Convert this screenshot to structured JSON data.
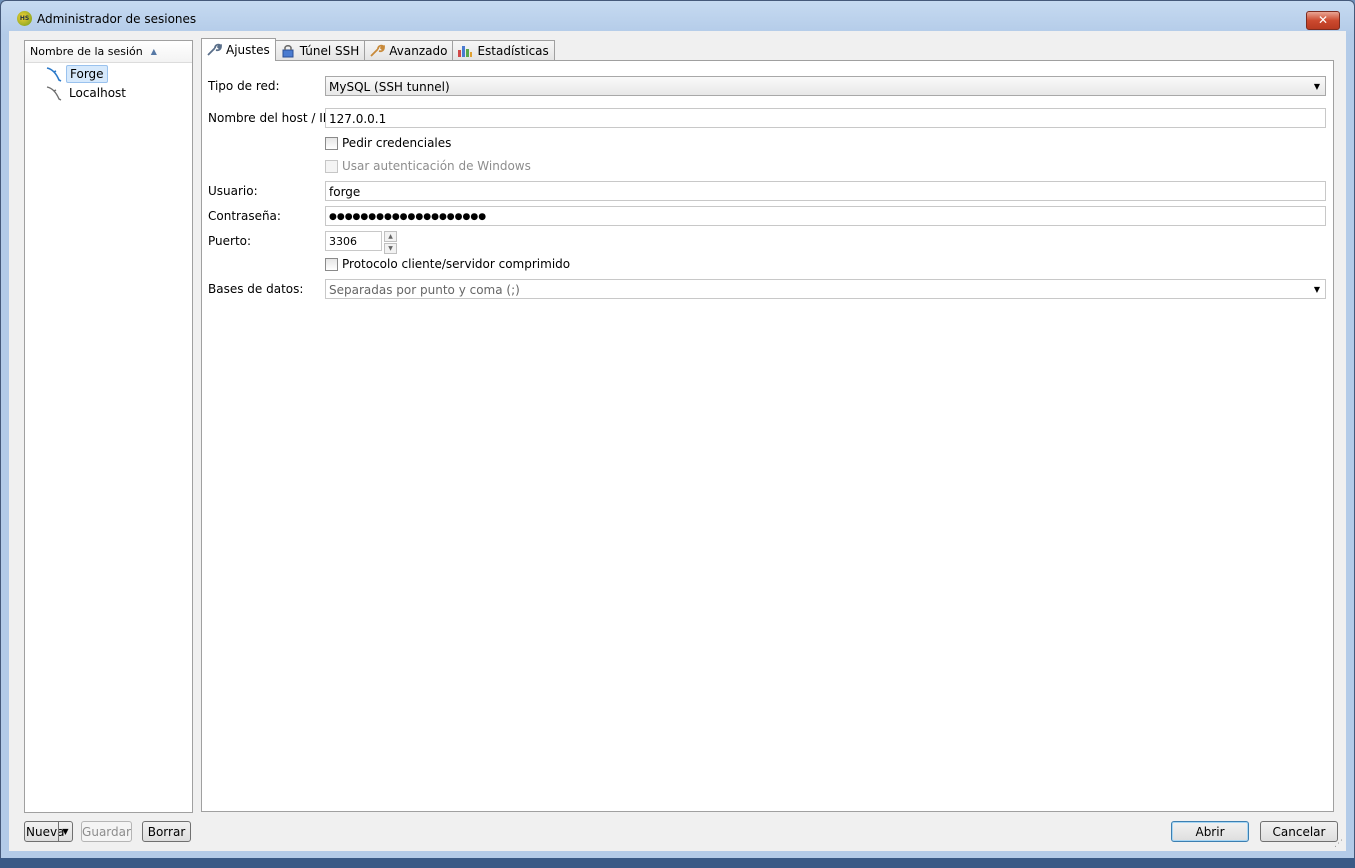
{
  "window": {
    "title": "Administrador de sesiones",
    "app_icon_text": "HS",
    "close_glyph": "✕"
  },
  "tree": {
    "header": "Nombre de la sesión",
    "sort_glyph": "▲",
    "items": [
      {
        "label": "Forge",
        "icon": "dolphin-icon",
        "selected": true
      },
      {
        "label": "Localhost",
        "icon": "dolphin-icon",
        "selected": false
      }
    ]
  },
  "tabs": [
    {
      "label": "Ajustes",
      "icon": "wrench-icon",
      "active": true
    },
    {
      "label": "Túnel SSH",
      "icon": "lock-icon",
      "active": false
    },
    {
      "label": "Avanzado",
      "icon": "wrench-icon",
      "active": false
    },
    {
      "label": "Estadísticas",
      "icon": "bar-chart-icon",
      "active": false
    }
  ],
  "settings": {
    "network_type_label": "Tipo de red:",
    "network_type_value": "MySQL (SSH tunnel)",
    "host_label": "Nombre del host / IP:",
    "host_value": "127.0.0.1",
    "prompt_credentials_label": "Pedir credenciales",
    "prompt_credentials_checked": false,
    "windows_auth_label": "Usar autenticación de Windows",
    "windows_auth_enabled": false,
    "user_label": "Usuario:",
    "user_value": "forge",
    "password_label": "Contraseña:",
    "password_value": "●●●●●●●●●●●●●●●●●●●●",
    "port_label": "Puerto:",
    "port_value": "3306",
    "compressed_label": "Protocolo cliente/servidor comprimido",
    "compressed_checked": false,
    "databases_label": "Bases de datos:",
    "databases_placeholder": "Separadas por punto y coma (;)",
    "dropdown_glyph": "▼",
    "spin_up_glyph": "▲",
    "spin_down_glyph": "▼"
  },
  "buttons": {
    "new": "Nueva",
    "new_arrow": "▼",
    "save": "Guardar",
    "delete": "Borrar",
    "open": "Abrir",
    "cancel": "Cancelar"
  },
  "colors": {
    "selection": "#d6e9fc",
    "title_gradient": "#c6daf1",
    "close_button": "#cc4a2f"
  }
}
